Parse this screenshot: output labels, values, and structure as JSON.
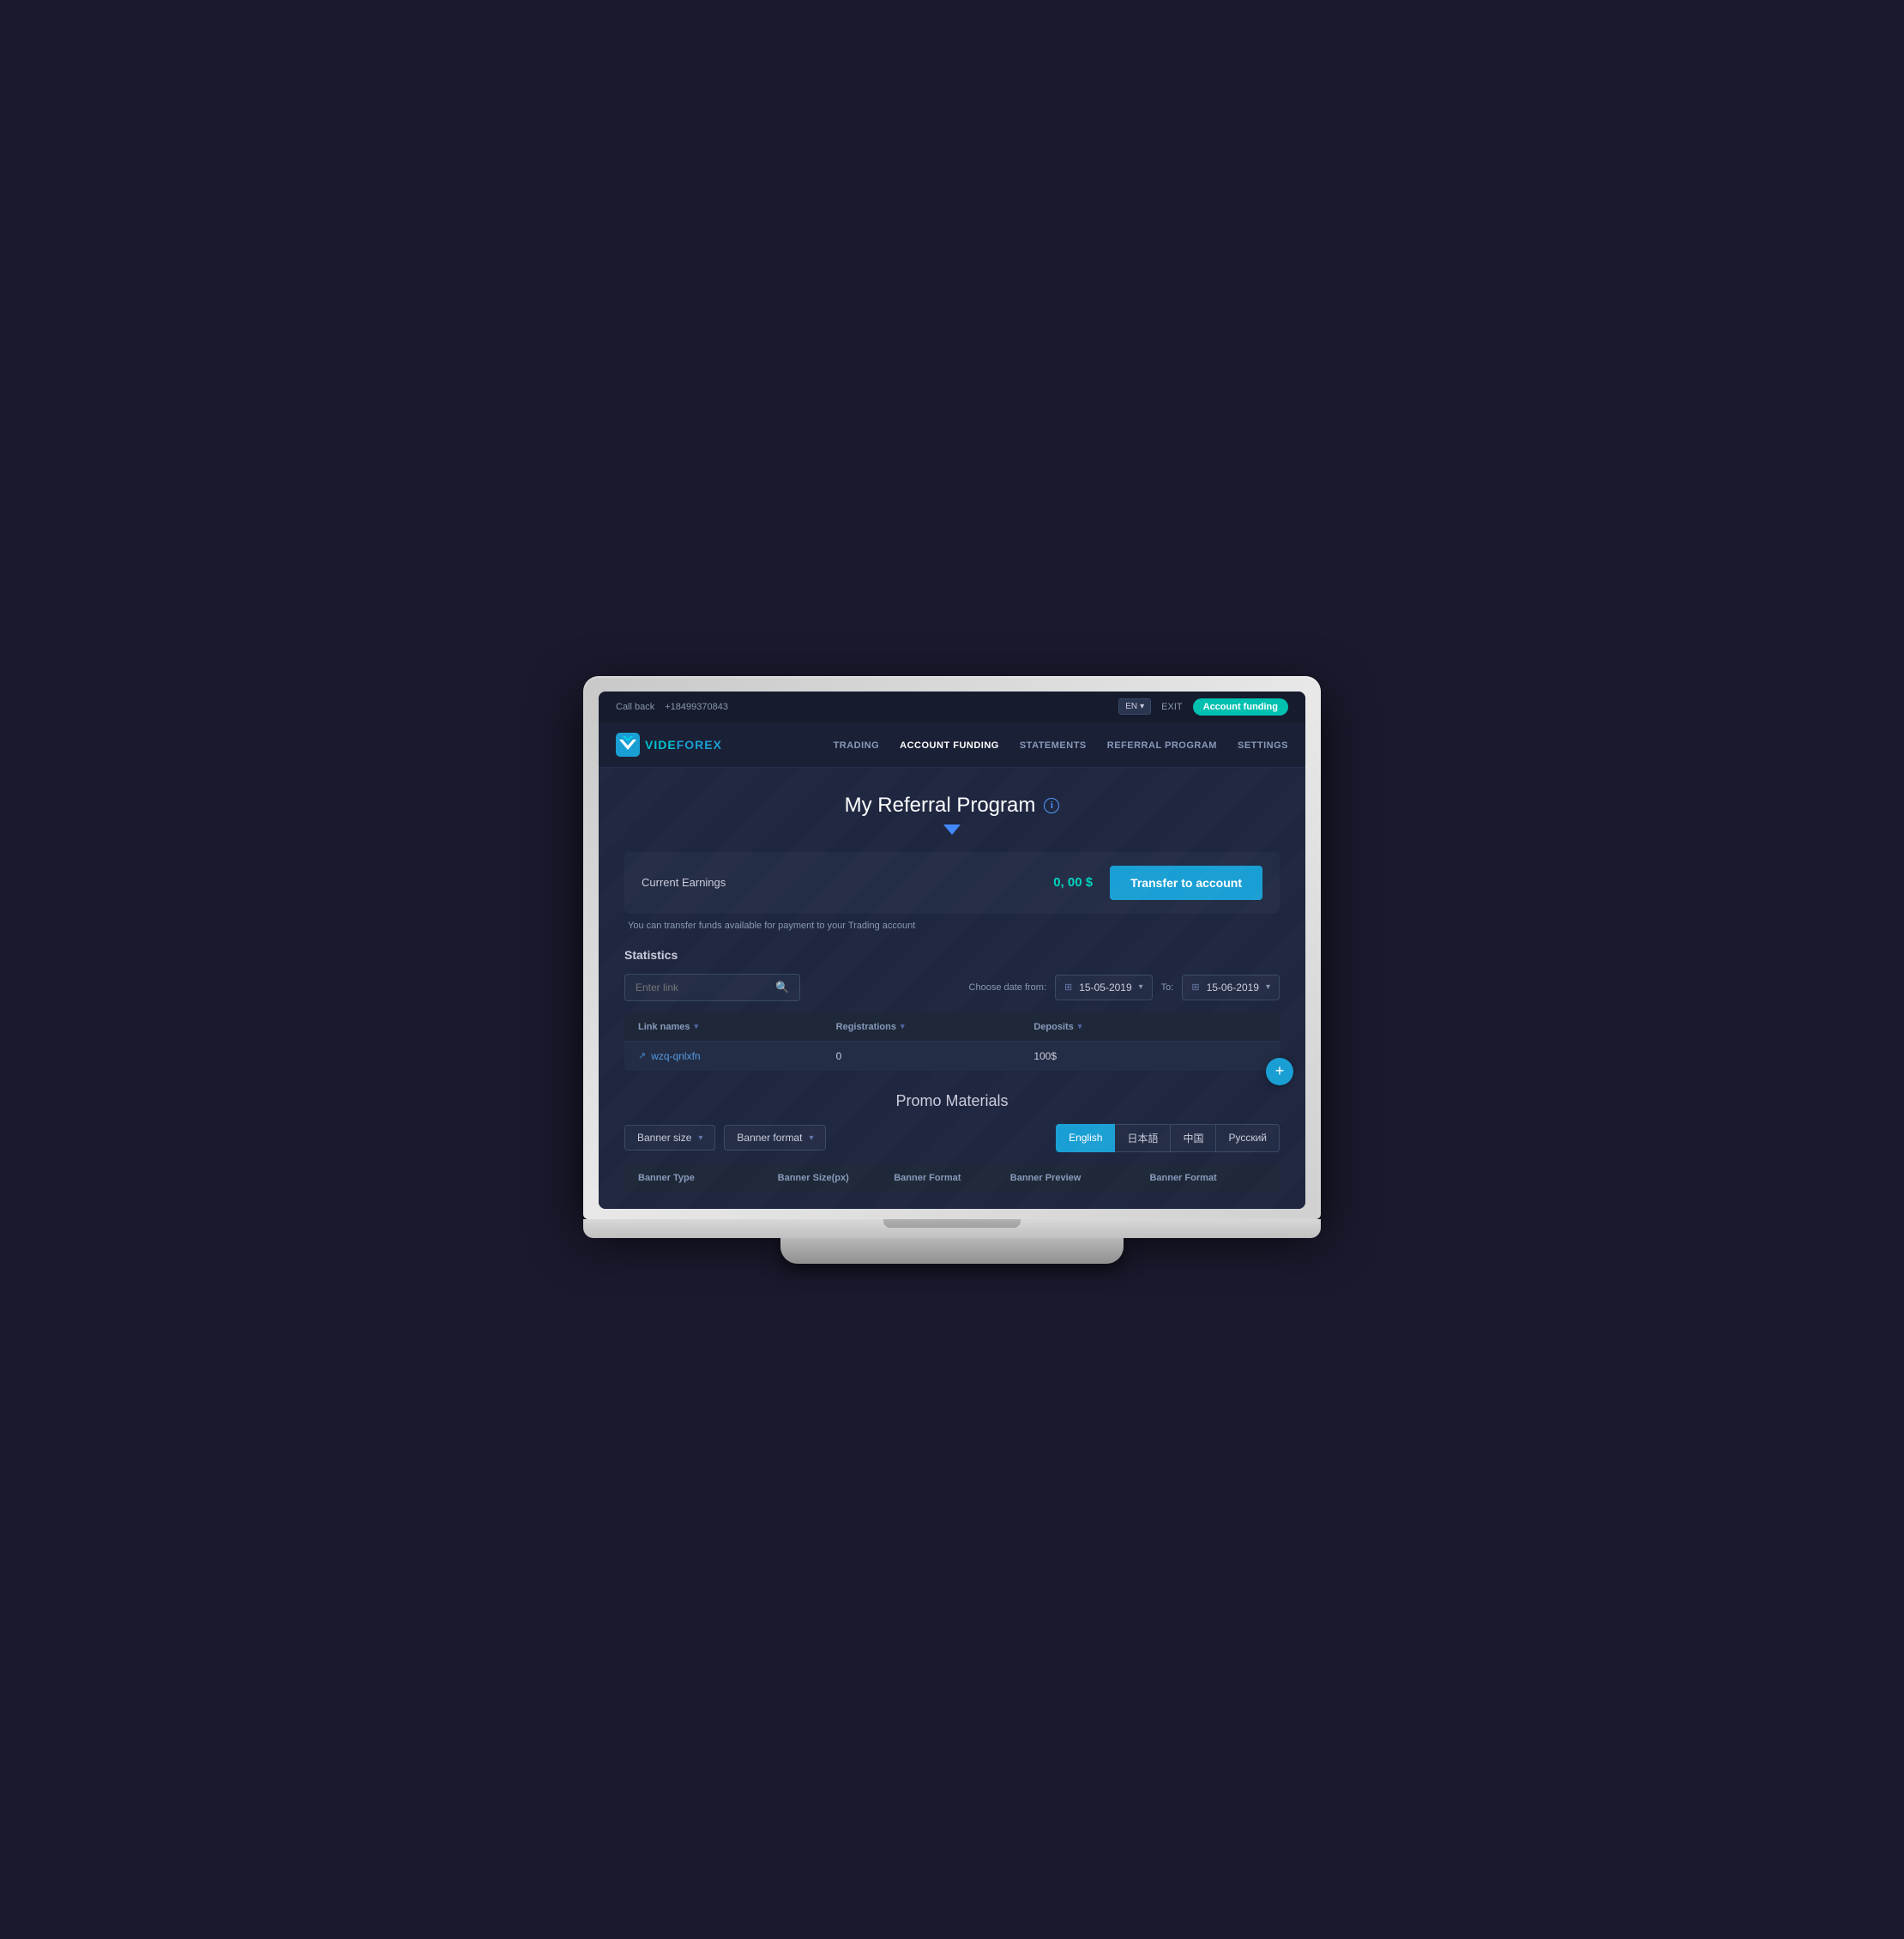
{
  "topbar": {
    "callback_label": "Call back",
    "phone": "+18499370843",
    "lang": "EN",
    "exit_label": "EXIT",
    "account_funding_label": "Account funding"
  },
  "navbar": {
    "logo_text_1": "VIDE",
    "logo_text_2": "FOREX",
    "links": [
      {
        "label": "TRADING",
        "active": false
      },
      {
        "label": "ACCOUNT FUNDING",
        "active": true
      },
      {
        "label": "STATEMENTS",
        "active": false
      },
      {
        "label": "REFERRAL PROGRAM",
        "active": false
      },
      {
        "label": "SETTINGS",
        "active": false
      }
    ]
  },
  "page": {
    "title": "My Referral Program",
    "info_icon": "i",
    "earnings": {
      "label": "Current Earnings",
      "value": "0, 00 $",
      "transfer_btn": "Transfer to account",
      "note": "You can transfer funds available for payment to your Trading account"
    },
    "statistics": {
      "section_label": "Statistics",
      "search_placeholder": "Enter link",
      "date_from_label": "Choose date from:",
      "date_from_value": "15-05-2019",
      "date_to_label": "To:",
      "date_to_value": "15-06-2019",
      "table": {
        "headers": [
          {
            "label": "Link names",
            "sortable": true
          },
          {
            "label": "Registrations",
            "sortable": true
          },
          {
            "label": "Deposits",
            "sortable": true
          }
        ],
        "rows": [
          {
            "link": "wzq-qnlxfn",
            "registrations": "0",
            "deposits": "100$"
          }
        ]
      }
    },
    "promo": {
      "title": "Promo Materials",
      "banner_size_label": "Banner size",
      "banner_format_label": "Banner format",
      "languages": [
        {
          "label": "English",
          "active": true
        },
        {
          "label": "日本語",
          "active": false
        },
        {
          "label": "中国",
          "active": false
        },
        {
          "label": "Русский",
          "active": false
        }
      ],
      "table_headers": [
        "Banner Type",
        "Banner Size(px)",
        "Banner Format",
        "Banner Preview",
        "Banner Format"
      ]
    }
  }
}
